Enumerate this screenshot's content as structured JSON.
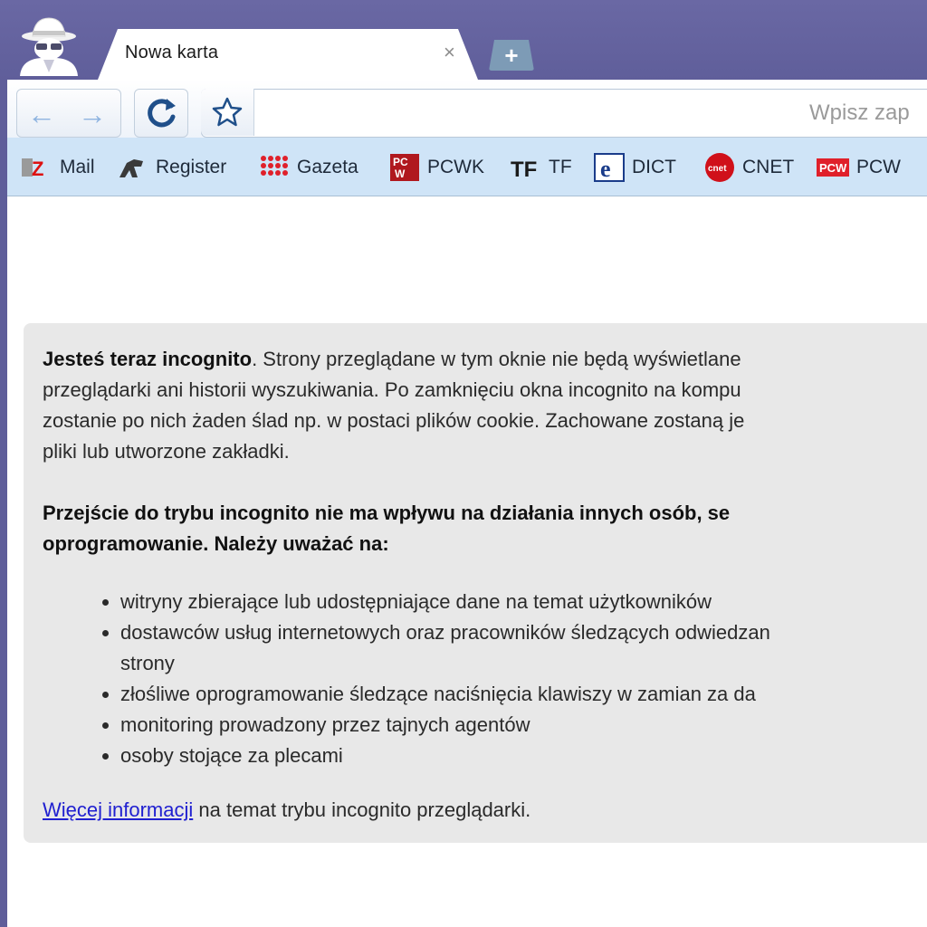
{
  "window": {
    "tab_title": "Nowa karta",
    "tab_close": "×",
    "new_tab": "+"
  },
  "toolbar": {
    "back": "←",
    "forward": "→",
    "omnibox_placeholder": "Wpisz zap"
  },
  "bookmarks": [
    {
      "label": "Mail",
      "icon": "ez-mail-icon"
    },
    {
      "label": "Register",
      "icon": "register-icon"
    },
    {
      "label": "Gazeta",
      "icon": "gazeta-icon"
    },
    {
      "label": "PCWK",
      "icon": "pcwk-icon"
    },
    {
      "label": "TF",
      "icon": "tf-icon"
    },
    {
      "label": "DICT",
      "icon": "dict-icon"
    },
    {
      "label": "CNET",
      "icon": "cnet-icon"
    },
    {
      "label": "PCW",
      "icon": "pcw-icon"
    }
  ],
  "incognito": {
    "intro_bold": "Jesteś teraz incognito",
    "intro_lines": [
      ". Strony przeglądane w tym oknie nie będą wyświetlane",
      "przeglądarki ani historii wyszukiwania. Po zamknięciu okna incognito na kompu",
      "zostanie po nich żaden ślad np. w postaci plików cookie. Zachowane zostaną je",
      "pliki lub utworzone zakładki."
    ],
    "warning_lines": [
      "Przejście do trybu incognito nie ma wpływu na działania innych osób, se",
      "oprogramowanie. Należy uważać na:"
    ],
    "bullets": [
      "witryny zbierające lub udostępniające dane na temat użytkowników",
      "dostawców usług internetowych oraz pracowników śledzących odwiedzan",
      "złośliwe oprogramowanie śledzące naciśnięcia klawiszy w zamian za da",
      "monitoring prowadzony przez tajnych agentów",
      "osoby stojące za plecami"
    ],
    "bullet2_continuation": "strony",
    "more_info_link": "Więcej informacji",
    "more_info_rest": " na temat trybu incognito przeglądarki."
  },
  "colors": {
    "frame": "#5f5e9a",
    "bookmarks_bar": "#cfe4f7",
    "panel": "#e8e8e8",
    "link": "#2020d0"
  }
}
